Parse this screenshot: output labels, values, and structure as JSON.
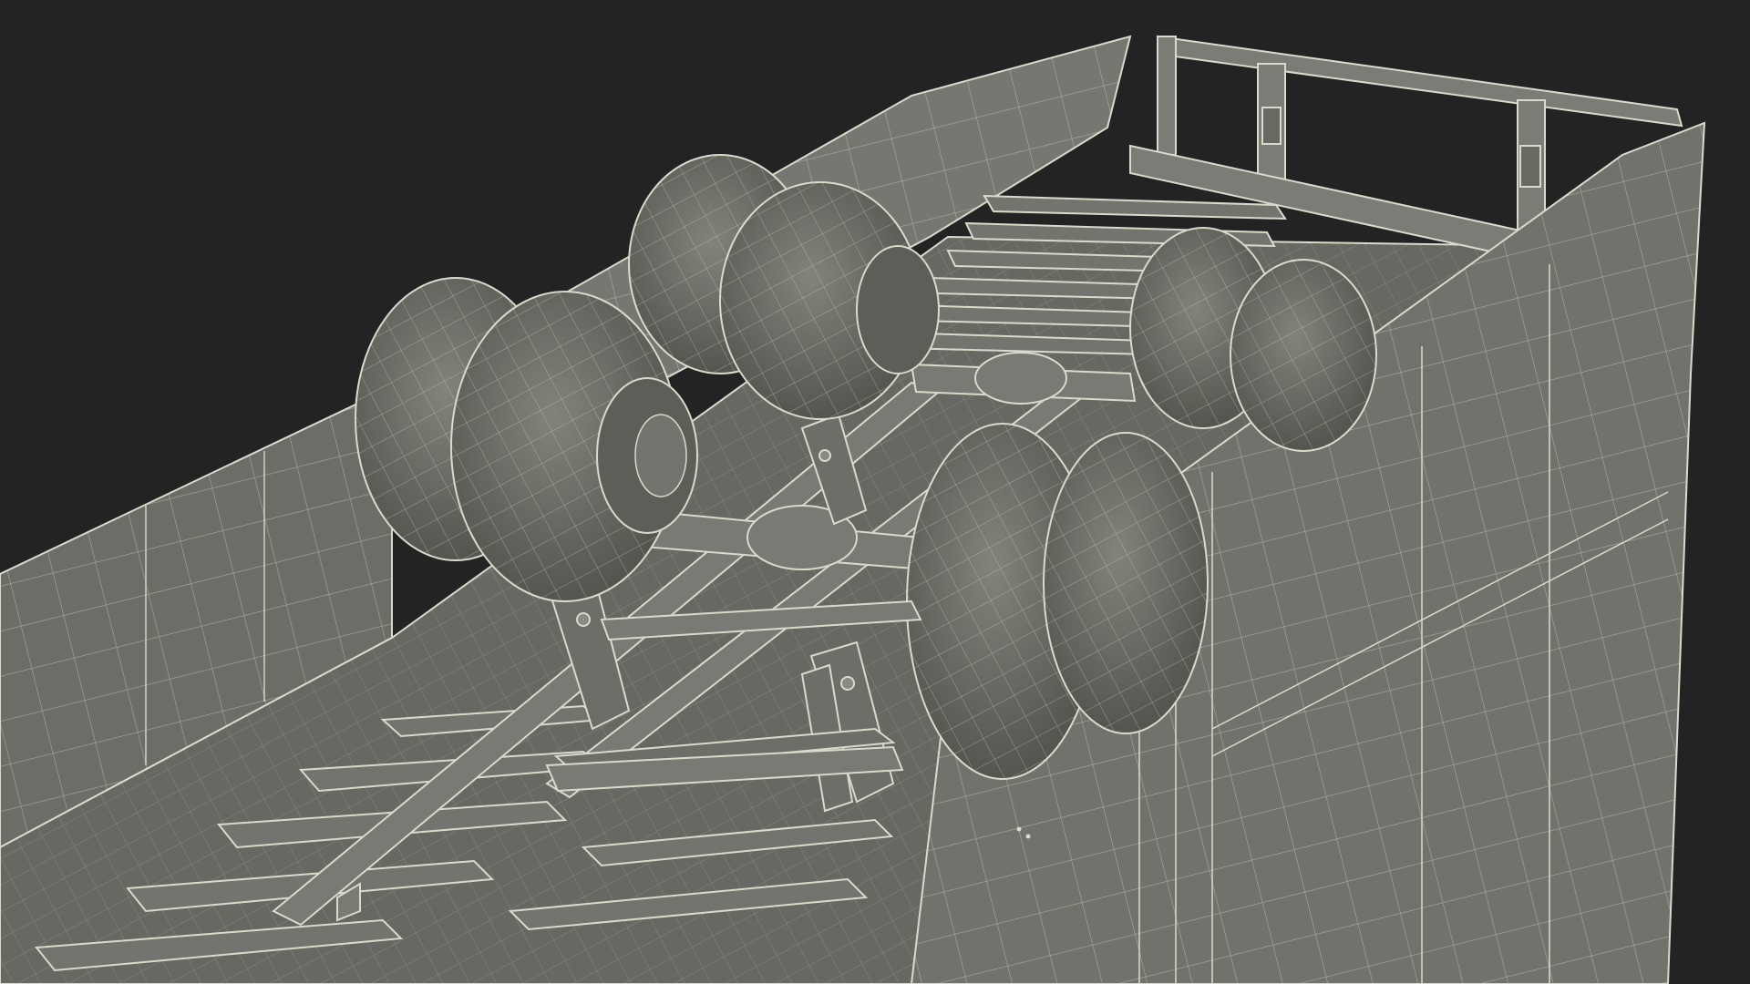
{
  "scene": {
    "background": "#232323",
    "surface": "#6f6f6a",
    "surface_dark": "#5b5b56",
    "surface_light": "#7c7c76",
    "wire": "#d9d9cc",
    "wire_dim": "#b9b9ad"
  }
}
